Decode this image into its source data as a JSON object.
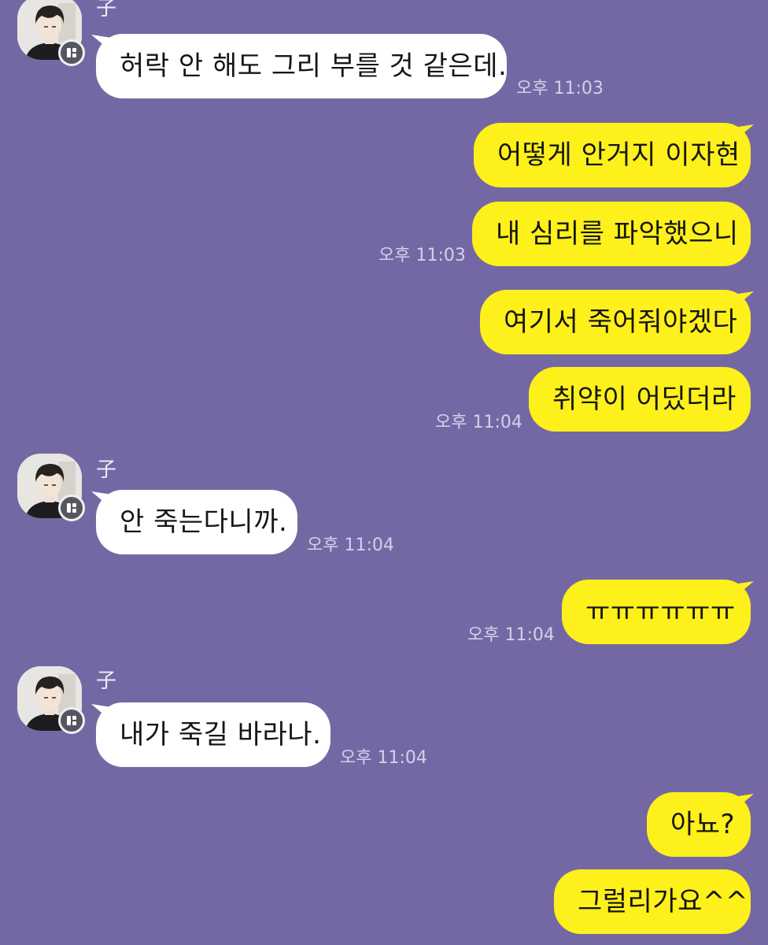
{
  "chat": {
    "colors": {
      "background": "#7468a4",
      "incoming_bubble": "#ffffff",
      "outgoing_bubble": "#fef01b",
      "timestamp": "#d5d0ea",
      "sender_name": "#efedf6"
    },
    "messages": [
      {
        "direction": "incoming",
        "sender": "子",
        "text": "허락 안 해도 그리 부를 것 같은데.",
        "time": "오후 11:03"
      },
      {
        "direction": "outgoing",
        "text": "어떻게 안거지 이자현",
        "time": ""
      },
      {
        "direction": "outgoing",
        "text": "내 심리를 파악했으니",
        "time": "오후 11:03"
      },
      {
        "direction": "outgoing",
        "text": "여기서 죽어줘야겠다",
        "time": ""
      },
      {
        "direction": "outgoing",
        "text": "취약이 어딨더라",
        "time": "오후 11:04"
      },
      {
        "direction": "incoming",
        "sender": "子",
        "text": "안 죽는다니까.",
        "time": "오후 11:04"
      },
      {
        "direction": "outgoing",
        "text": "ㅠㅠㅠㅠㅠㅠ",
        "time": "오후 11:04"
      },
      {
        "direction": "incoming",
        "sender": "子",
        "text": "내가 죽길 바라나.",
        "time": "오후 11:04"
      },
      {
        "direction": "outgoing",
        "text": "아뇨?",
        "time": ""
      },
      {
        "direction": "outgoing",
        "text": "그럴리가요^^",
        "time": ""
      }
    ]
  }
}
